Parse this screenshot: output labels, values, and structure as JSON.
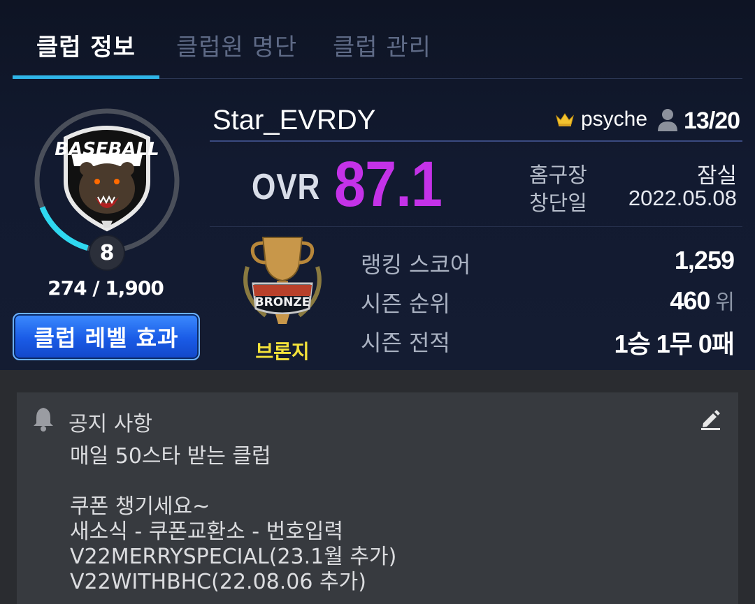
{
  "tabs": [
    {
      "label": "클럽 정보",
      "active": true
    },
    {
      "label": "클럽원 명단",
      "active": false
    },
    {
      "label": "클럽 관리",
      "active": false
    }
  ],
  "club": {
    "level": "8",
    "xp_text": "274 / 1,900",
    "xp_progress": 0.144,
    "level_button": "클럽 레벨 효과",
    "name": "Star_EVRDY",
    "master": "psyche",
    "members": "13/20",
    "ovr_label": "OVR",
    "ovr_value": "87.1",
    "info": [
      {
        "label": "홈구장",
        "value": "잠실"
      },
      {
        "label": "창단일",
        "value": "2022.05.08"
      }
    ],
    "emblem_text": "BASEBALL",
    "tier_badge_text": "BRONZE",
    "tier_name": "브론지",
    "stats": [
      {
        "label": "랭킹 스코어",
        "value": "1,259",
        "unit": ""
      },
      {
        "label": "시즌 순위",
        "value": "460",
        "unit": "위"
      },
      {
        "label": "시즌 전적",
        "value": "1승 1무 0패",
        "unit": ""
      }
    ]
  },
  "notice": {
    "title": "공지 사항",
    "lines": [
      "매일 50스타 받는 클럽",
      "",
      "쿠폰 챙기세요~",
      "새소식 - 쿠폰교환소 - 번호입력",
      "V22MERRYSPECIAL(23.1월 추가)",
      "V22WITHBHC(22.08.06 추가)"
    ]
  },
  "colors": {
    "accent": "#2fb5e8",
    "ovr": "#c432e8",
    "tier": "#f4e23a",
    "button": "#1a5be6"
  },
  "icons": [
    "crown-icon",
    "person-icon",
    "bell-icon",
    "edit-icon",
    "club-emblem",
    "bronze-trophy"
  ]
}
